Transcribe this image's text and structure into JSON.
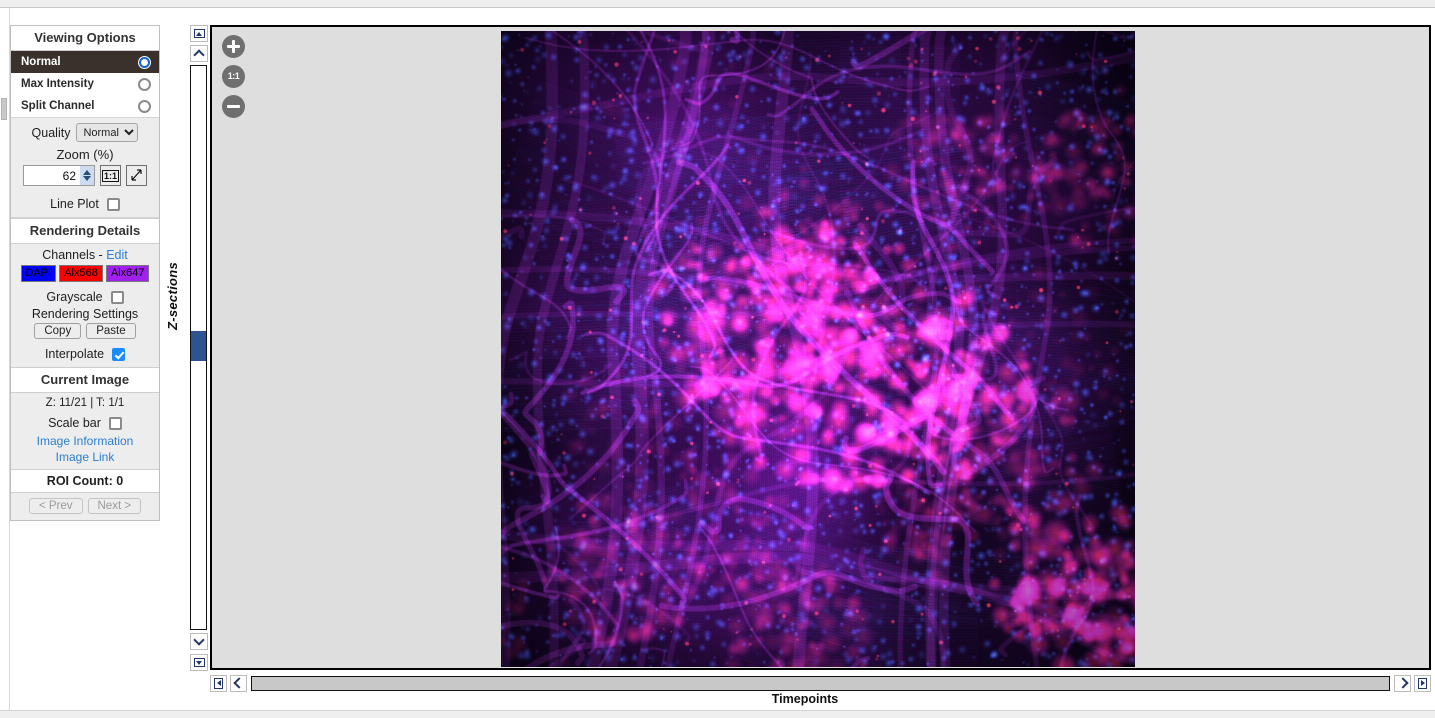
{
  "panel": {
    "viewing_options_title": "Viewing Options",
    "view_modes": [
      {
        "label": "Normal",
        "selected": true
      },
      {
        "label": "Max Intensity",
        "selected": false
      },
      {
        "label": "Split Channel",
        "selected": false
      }
    ],
    "quality_label": "Quality",
    "quality_value": "Normal",
    "quality_options": [
      "Normal"
    ],
    "zoom_title": "Zoom (%)",
    "zoom_value": "62",
    "one_to_one_label": "1:1",
    "fit_label": "fit-to-window-icon",
    "line_plot_label": "Line Plot",
    "line_plot_checked": false,
    "rendering_details_title": "Rendering Details",
    "channels_label": "Channels -",
    "channels_edit_label": "Edit",
    "channels": [
      {
        "name": "DAPI",
        "color": "#0000FF",
        "text_color": "#000000",
        "active": true
      },
      {
        "name": "Alx568",
        "color": "#FF0000",
        "text_color": "#000000",
        "active": true
      },
      {
        "name": "Alx647",
        "color": "#A020F0",
        "text_color": "#000000",
        "active": true
      }
    ],
    "grayscale_label": "Grayscale",
    "grayscale_checked": false,
    "rendering_settings_label": "Rendering Settings",
    "copy_label": "Copy",
    "paste_label": "Paste",
    "interpolate_label": "Interpolate",
    "interpolate_checked": true,
    "current_image_title": "Current Image",
    "zt_text": "Z: 11/21 | T: 1/1",
    "scale_bar_label": "Scale bar",
    "scale_bar_checked": false,
    "image_information_label": "Image Information",
    "image_link_label": "Image Link",
    "roi_count_label": "ROI Count: 0",
    "prev_label": "< Prev",
    "next_label": "Next >"
  },
  "zslider": {
    "axis_label": "Z-sections",
    "top_button": "jump-to-top-icon",
    "up_button": "step-up-icon",
    "down_button": "step-down-icon",
    "bottom_button": "jump-to-bottom-icon",
    "current": 11,
    "total": 21
  },
  "viewer": {
    "zoom_in_icon": "zoom-in-icon",
    "one_to_one_icon": "zoom-100-icon",
    "zoom_out_icon": "zoom-out-icon"
  },
  "timeline": {
    "label": "Timepoints",
    "first_button": "jump-to-first-icon",
    "prev_button": "step-back-icon",
    "next_button": "step-forward-icon",
    "last_button": "jump-to-last-icon",
    "current": 1,
    "total": 1
  },
  "image_render": {
    "description": "fluorescence-microscopy-tissue-section",
    "background": "#07020f",
    "channel_colors": [
      "#2040d0",
      "#e02030",
      "#b030e0"
    ],
    "seed": 20114
  }
}
